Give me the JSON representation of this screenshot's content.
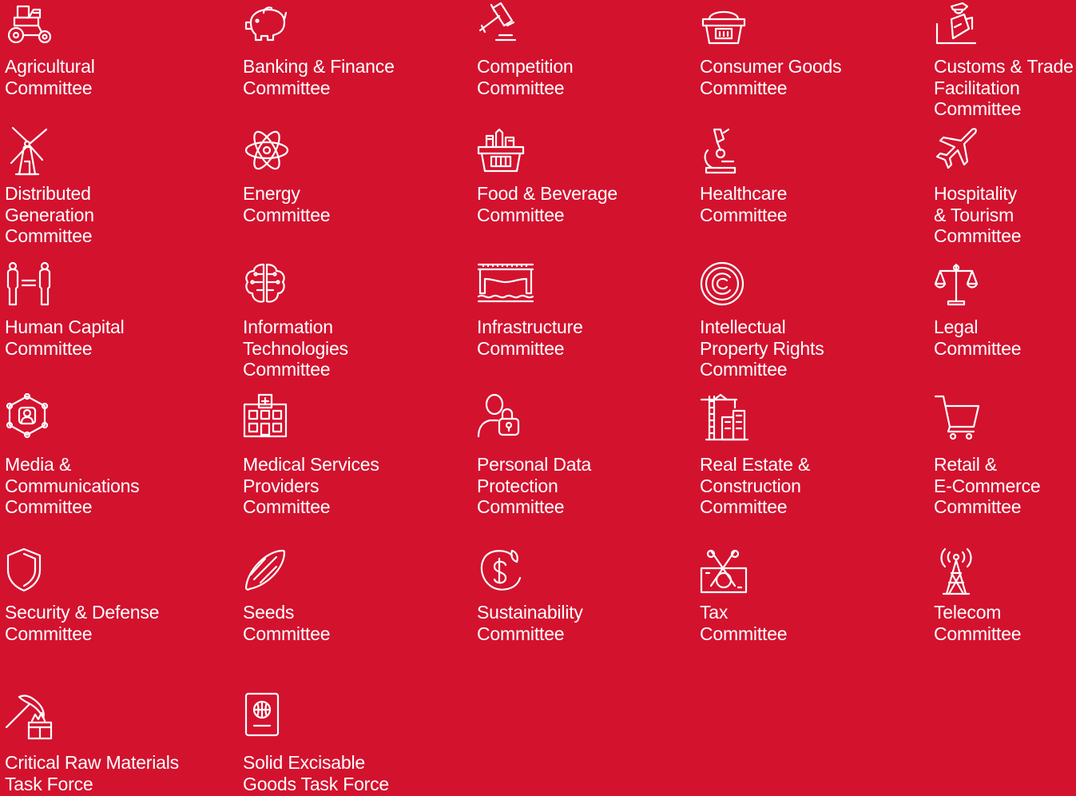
{
  "theme": {
    "background": "#d3122e",
    "foreground": "#ffffff"
  },
  "committees": [
    {
      "icon": "tractor-icon",
      "lines": [
        "Agricultural",
        "Committee"
      ]
    },
    {
      "icon": "piggy-bank-icon",
      "lines": [
        "Banking & Finance",
        "Committee"
      ]
    },
    {
      "icon": "gavel-icon",
      "lines": [
        "Competition",
        "Committee"
      ]
    },
    {
      "icon": "shopping-basket-icon",
      "lines": [
        "Consumer Goods",
        "Committee"
      ]
    },
    {
      "icon": "customs-officer-icon",
      "lines": [
        "Customs & Trade",
        "Facilitation",
        "Committee"
      ]
    },
    {
      "icon": "windmill-icon",
      "lines": [
        "Distributed",
        "Generation",
        "Committee"
      ]
    },
    {
      "icon": "atom-icon",
      "lines": [
        "Energy",
        "Committee"
      ]
    },
    {
      "icon": "grocery-basket-icon",
      "lines": [
        "Food & Beverage",
        "Committee"
      ]
    },
    {
      "icon": "microscope-icon",
      "lines": [
        "Healthcare",
        "Committee"
      ]
    },
    {
      "icon": "airplane-icon",
      "lines": [
        "Hospitality",
        "& Tourism",
        "Committee"
      ]
    },
    {
      "icon": "people-equal-icon",
      "lines": [
        "Human Capital",
        "Committee"
      ]
    },
    {
      "icon": "circuit-brain-icon",
      "lines": [
        "Information",
        "Technologies",
        "Committee"
      ]
    },
    {
      "icon": "bridge-icon",
      "lines": [
        "Infrastructure",
        "Committee"
      ]
    },
    {
      "icon": "copyright-icon",
      "lines": [
        "Intellectual",
        "Property Rights",
        "Committee"
      ]
    },
    {
      "icon": "scales-icon",
      "lines": [
        "Legal",
        "Committee"
      ]
    },
    {
      "icon": "network-user-icon",
      "lines": [
        "Media &",
        "Communications",
        "Committee"
      ]
    },
    {
      "icon": "hospital-icon",
      "lines": [
        "Medical Services",
        "Providers",
        "Committee"
      ]
    },
    {
      "icon": "user-lock-icon",
      "lines": [
        "Personal Data",
        "Protection",
        "Committee"
      ]
    },
    {
      "icon": "crane-buildings-icon",
      "lines": [
        "Real Estate &",
        "Construction",
        "Committee"
      ]
    },
    {
      "icon": "shopping-cart-icon",
      "lines": [
        "Retail &",
        "E-Commerce",
        "Committee"
      ]
    },
    {
      "icon": "shield-icon",
      "lines": [
        "Security & Defense",
        "Committee"
      ]
    },
    {
      "icon": "seed-icon",
      "lines": [
        "Seeds",
        "Committee"
      ]
    },
    {
      "icon": "sustainability-icon",
      "lines": [
        "Sustainability",
        "Committee"
      ]
    },
    {
      "icon": "tax-banknote-icon",
      "lines": [
        "Tax",
        "Committee"
      ]
    },
    {
      "icon": "antenna-tower-icon",
      "lines": [
        "Telecom",
        "Committee"
      ]
    },
    {
      "icon": "pickaxe-ore-icon",
      "lines": [
        "Critical Raw Materials",
        "Task Force"
      ]
    },
    {
      "icon": "passport-icon",
      "lines": [
        "Solid Excisable",
        "Goods Task Force"
      ]
    }
  ]
}
